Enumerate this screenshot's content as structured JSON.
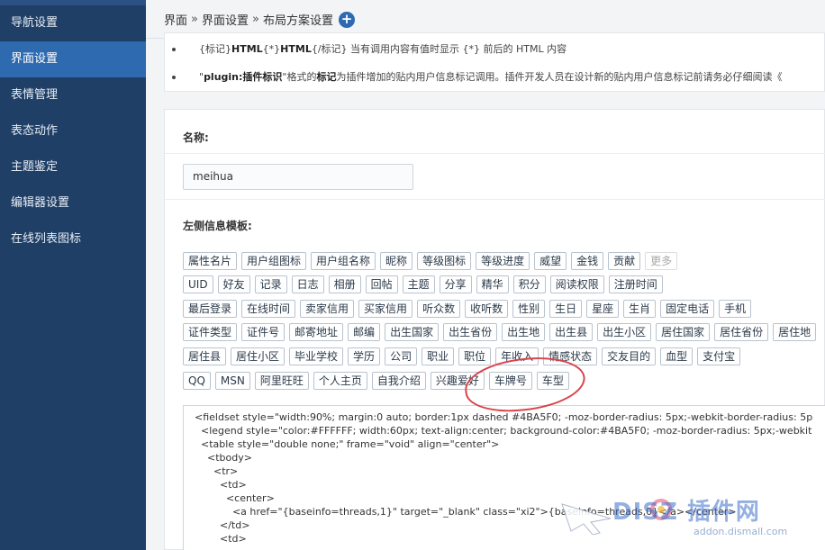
{
  "sidebar": {
    "items": [
      {
        "label": "导航设置"
      },
      {
        "label": "界面设置"
      },
      {
        "label": "表情管理"
      },
      {
        "label": "表态动作"
      },
      {
        "label": "主题鉴定"
      },
      {
        "label": "编辑器设置"
      },
      {
        "label": "在线列表图标"
      }
    ],
    "active_index": 1
  },
  "header": {
    "crumb1": "界面",
    "sep": "»",
    "crumb2": "界面设置",
    "crumb3": "布局方案设置",
    "add_icon": "plus-circle-icon"
  },
  "tips": {
    "line1_pre": "{标记}",
    "line1_b1": "HTML",
    "line1_mid1": "{*}",
    "line1_b2": "HTML",
    "line1_mid2": "{/标记}",
    "line1_post": " 当有调用内容有值时显示 {*} 前后的 HTML 内容",
    "line2_pre": "\"",
    "line2_b": "plugin:插件标识",
    "line2_mid": "\"格式的",
    "line2_b2": "标记",
    "line2_post": "为插件增加的贴内用户信息标记调用。插件开发人员在设计新的贴内用户信息标记前请务必仔细阅读《"
  },
  "form": {
    "name_label": "名称:",
    "name_value": "meihua",
    "template_label": "左侧信息模板:"
  },
  "tag_rows": [
    [
      "属性名片",
      "用户组图标",
      "用户组名称",
      "昵称",
      "等级图标",
      "等级进度",
      "威望",
      "金钱",
      "贡献",
      "更多"
    ],
    [
      "UID",
      "好友",
      "记录",
      "日志",
      "相册",
      "回帖",
      "主题",
      "分享",
      "精华",
      "积分",
      "阅读权限",
      "注册时间"
    ],
    [
      "最后登录",
      "在线时间",
      "卖家信用",
      "买家信用",
      "听众数",
      "收听数",
      "性别",
      "生日",
      "星座",
      "生肖",
      "固定电话",
      "手机"
    ],
    [
      "证件类型",
      "证件号",
      "邮寄地址",
      "邮编",
      "出生国家",
      "出生省份",
      "出生地",
      "出生县",
      "出生小区",
      "居住国家",
      "居住省份",
      "居住地"
    ],
    [
      "居住县",
      "居住小区",
      "毕业学校",
      "学历",
      "公司",
      "职业",
      "职位",
      "年收入",
      "情感状态",
      "交友目的",
      "血型",
      "支付宝"
    ],
    [
      "QQ",
      "MSN",
      "阿里旺旺",
      "个人主页",
      "自我介绍",
      "兴趣爱好",
      "车牌号",
      "车型"
    ]
  ],
  "disabled_tags": [
    "更多"
  ],
  "code_lines": [
    "<fieldset style=\"width:90%; margin:0 auto; border:1px dashed #4BA5F0; -moz-border-radius: 5px;-webkit-border-radius: 5p",
    "  <legend style=\"color:#FFFFFF; width:60px; text-align:center; background-color:#4BA5F0; -moz-border-radius: 5px;-webkit",
    "  <table style=\"double none;\" frame=\"void\" align=\"center\">",
    "    <tbody>",
    "      <tr>",
    "        <td>",
    "          <center>",
    "            <a href=\"{baseinfo=threads,1}\" target=\"_blank\" class=\"xi2\">{baseinfo=threads,0}</a></center>",
    "        </td>",
    "        <td>"
  ],
  "watermark": {
    "big": "DISZ 插件网",
    "small": "addon.dismall.com"
  }
}
